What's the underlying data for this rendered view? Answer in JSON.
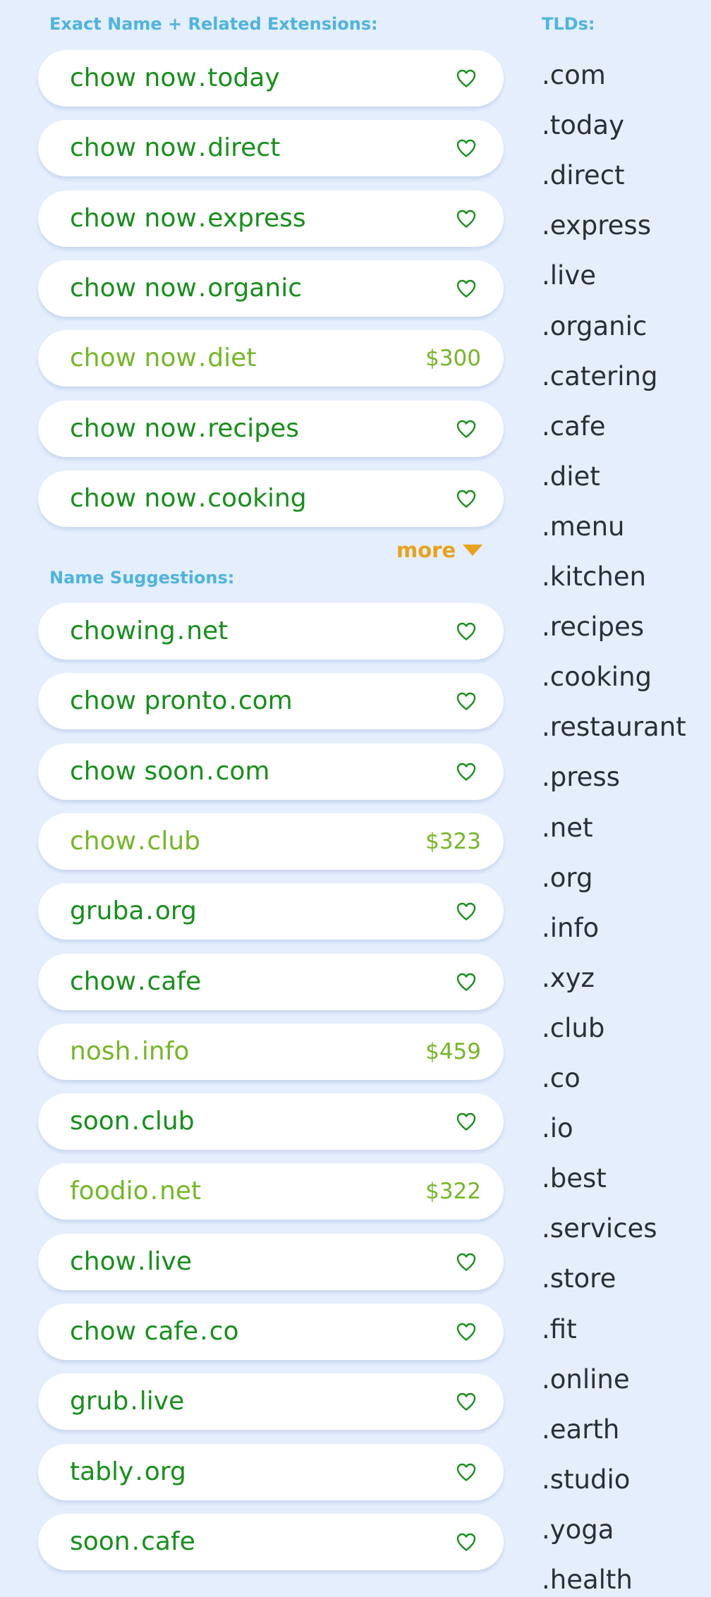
{
  "exact_section": {
    "title": "Exact Name + Related Extensions:",
    "items": [
      {
        "sld": "chow now",
        "tld": "today",
        "premium": false,
        "price": ""
      },
      {
        "sld": "chow now",
        "tld": "direct",
        "premium": false,
        "price": ""
      },
      {
        "sld": "chow now",
        "tld": "express",
        "premium": false,
        "price": ""
      },
      {
        "sld": "chow now",
        "tld": "organic",
        "premium": false,
        "price": ""
      },
      {
        "sld": "chow now",
        "tld": "diet",
        "premium": true,
        "price": "$300"
      },
      {
        "sld": "chow now",
        "tld": "recipes",
        "premium": false,
        "price": ""
      },
      {
        "sld": "chow now",
        "tld": "cooking",
        "premium": false,
        "price": ""
      }
    ],
    "more_label": "more"
  },
  "suggestions_section": {
    "title": "Name Suggestions:",
    "items": [
      {
        "sld": "chowing",
        "tld": "net",
        "premium": false,
        "price": ""
      },
      {
        "sld": "chow pronto",
        "tld": "com",
        "premium": false,
        "price": ""
      },
      {
        "sld": "chow soon",
        "tld": "com",
        "premium": false,
        "price": ""
      },
      {
        "sld": "chow",
        "tld": "club",
        "premium": true,
        "price": "$323"
      },
      {
        "sld": "gruba",
        "tld": "org",
        "premium": false,
        "price": ""
      },
      {
        "sld": "chow",
        "tld": "cafe",
        "premium": false,
        "price": ""
      },
      {
        "sld": "nosh",
        "tld": "info",
        "premium": true,
        "price": "$459"
      },
      {
        "sld": "soon",
        "tld": "club",
        "premium": false,
        "price": ""
      },
      {
        "sld": "foodio",
        "tld": "net",
        "premium": true,
        "price": "$322"
      },
      {
        "sld": "chow",
        "tld": "live",
        "premium": false,
        "price": ""
      },
      {
        "sld": "chow cafe",
        "tld": "co",
        "premium": false,
        "price": ""
      },
      {
        "sld": "grub",
        "tld": "live",
        "premium": false,
        "price": ""
      },
      {
        "sld": "tably",
        "tld": "org",
        "premium": false,
        "price": ""
      },
      {
        "sld": "soon",
        "tld": "cafe",
        "premium": false,
        "price": ""
      }
    ]
  },
  "tlds": {
    "title": "TLDs:",
    "items": [
      ".com",
      ".today",
      ".direct",
      ".express",
      ".live",
      ".organic",
      ".catering",
      ".cafe",
      ".diet",
      ".menu",
      ".kitchen",
      ".recipes",
      ".cooking",
      ".restaurant",
      ".press",
      ".net",
      ".org",
      ".info",
      ".xyz",
      ".club",
      ".co",
      ".io",
      ".best",
      ".services",
      ".store",
      ".fit",
      ".online",
      ".earth",
      ".studio",
      ".yoga",
      ".health"
    ]
  },
  "colors": {
    "background": "#e4eefd",
    "available_green": "#168f1a",
    "premium_green": "#74b726",
    "section_title_blue": "#4fb3e0",
    "more_orange": "#e7a21c"
  },
  "icons": {
    "favorite": "heart-outline-icon",
    "more": "caret-down-icon"
  }
}
